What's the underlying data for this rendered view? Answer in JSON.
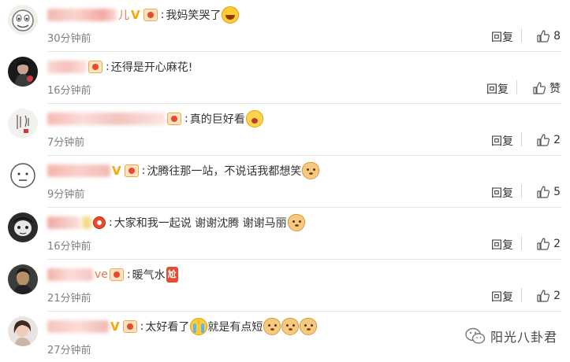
{
  "reply_label": "回复",
  "comments": [
    {
      "text": "我妈笑哭了",
      "time": "30分钟前",
      "likes": "8",
      "emoji": "laugh-cry",
      "name_tail": "儿"
    },
    {
      "text": "还得是开心麻花!",
      "time": "16分钟前",
      "likes": "赞",
      "emoji": "",
      "name_tail": ""
    },
    {
      "text": "真的巨好看",
      "time": "7分钟前",
      "likes": "2",
      "emoji": "cheer",
      "name_tail": ""
    },
    {
      "text": "沈腾往那一站，不说话我都想笑",
      "time": "9分钟前",
      "likes": "5",
      "emoji": "doge",
      "name_tail": ""
    },
    {
      "text": "大家和我一起说 谢谢沈腾 谢谢马丽",
      "time": "16分钟前",
      "likes": "2",
      "emoji": "doge",
      "name_tail": ""
    },
    {
      "text": "暖气水",
      "time": "21分钟前",
      "likes": "2",
      "emoji": "sticker",
      "sticker_text": "尬",
      "name_tail": "ve"
    },
    {
      "text": "太好看了",
      "text2": "就是有点短",
      "time": "27分钟前",
      "likes": "",
      "emoji": "cry",
      "name_tail": ""
    }
  ],
  "watermark": {
    "text": "阳光八卦君",
    "icon": "wechat-icon"
  },
  "colors": {
    "name": "#eb7350",
    "vip": "#f7a700",
    "time": "#808080",
    "text": "#333333"
  }
}
